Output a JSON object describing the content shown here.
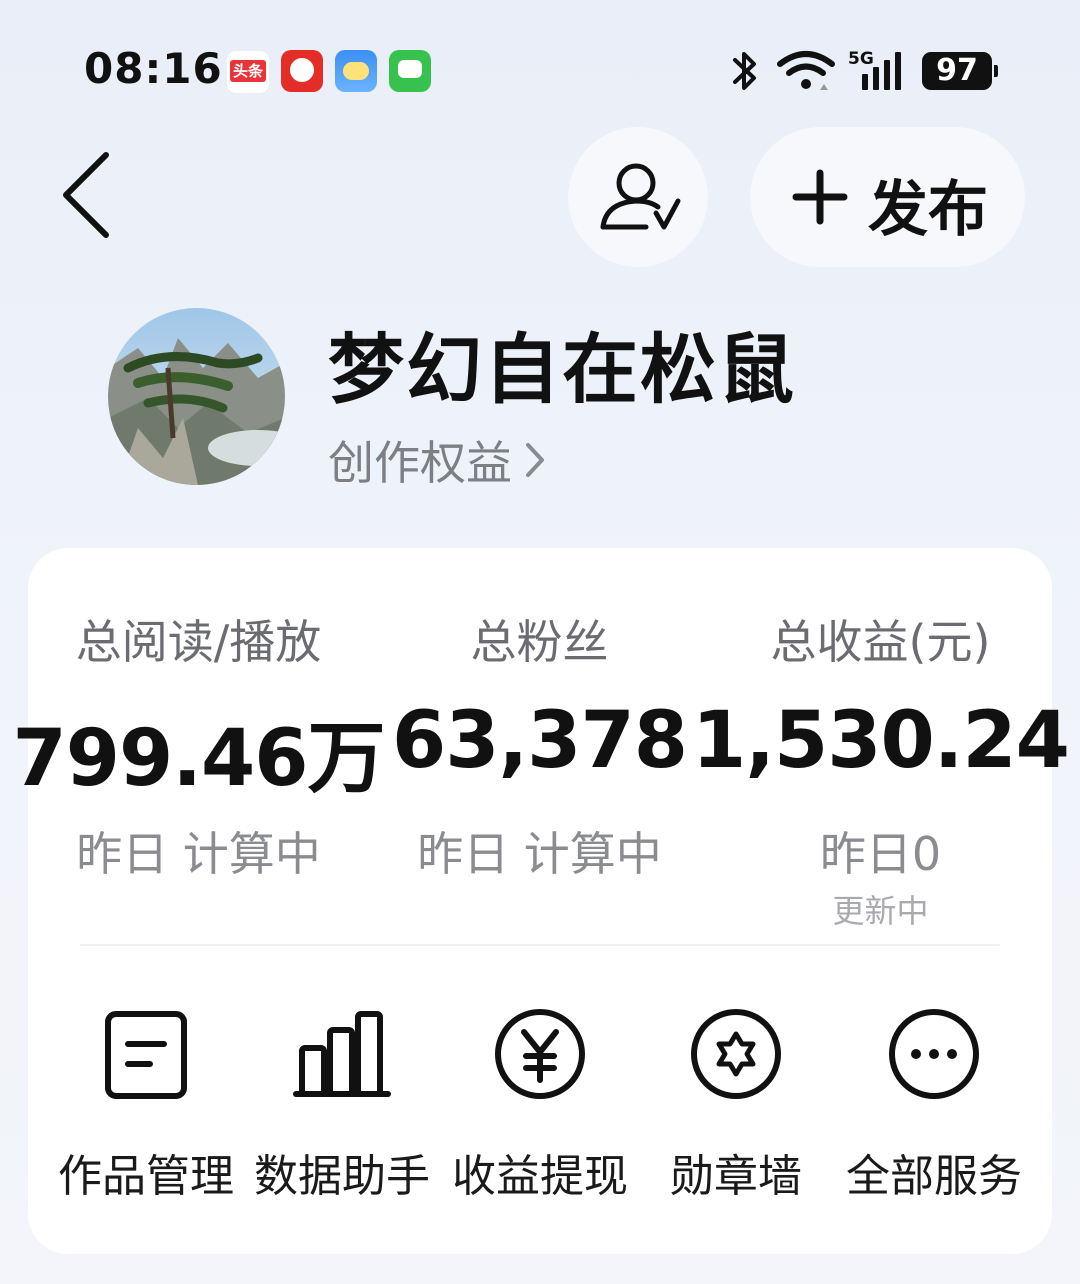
{
  "status_bar": {
    "time": "08:16",
    "toutiao_label": "头条",
    "network": "5G",
    "battery": "97"
  },
  "header": {
    "publish_label": "发布"
  },
  "profile": {
    "name": "梦幻自在松鼠",
    "rights_link": "创作权益"
  },
  "stats": [
    {
      "label": "总阅读/播放",
      "value": "799.46万",
      "sub": "昨日 计算中",
      "note": ""
    },
    {
      "label": "总粉丝",
      "value": "63,378",
      "sub": "昨日 计算中",
      "note": ""
    },
    {
      "label": "总收益(元)",
      "value": "1,530.24",
      "sub": "昨日0",
      "note": "更新中"
    }
  ],
  "services": [
    {
      "label": "作品管理",
      "icon": "document-icon"
    },
    {
      "label": "数据助手",
      "icon": "bar-chart-icon"
    },
    {
      "label": "收益提现",
      "icon": "yuan-icon"
    },
    {
      "label": "勋章墙",
      "icon": "medal-icon"
    },
    {
      "label": "全部服务",
      "icon": "more-icon"
    }
  ],
  "colors": {
    "background": "#eef2fa",
    "card": "#ffffff",
    "primary_text": "#111111",
    "secondary_text": "#7d7f85"
  }
}
